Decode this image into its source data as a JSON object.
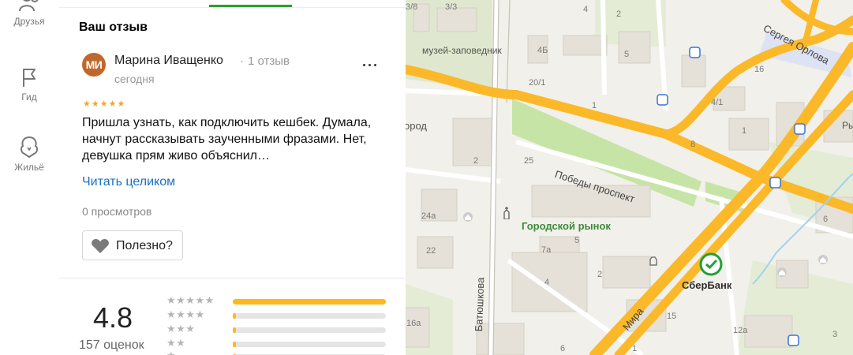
{
  "sidebar": {
    "items": [
      {
        "label": "Друзья",
        "icon": "friends-icon"
      },
      {
        "label": "Гид",
        "icon": "flag-icon"
      },
      {
        "label": "Жильё",
        "icon": "house-icon"
      }
    ]
  },
  "review": {
    "section_title": "Ваш отзыв",
    "author_initials": "МИ",
    "author_name": "Марина Иващенко",
    "author_reviews": "1 отзыв",
    "date": "сегодня",
    "stars": "★★★★★",
    "text": "Пришла узнать, как подключить кешбек. Думала, начнут рассказывать заученными фразами. Нет, девушка прям живо объяснил…",
    "read_more": "Читать целиком",
    "views": "0 просмотров",
    "useful_label": "Полезно?"
  },
  "rating": {
    "value": "4.8",
    "count": "157 оценок",
    "distribution": [
      {
        "stars": "★★★★★",
        "fraction": 1.0
      },
      {
        "stars": "★★★★",
        "fraction": 0.02
      },
      {
        "stars": "★★★",
        "fraction": 0.02
      },
      {
        "stars": "★★",
        "fraction": 0.02
      },
      {
        "stars": "★",
        "fraction": 0.02
      }
    ]
  },
  "map": {
    "labels": {
      "museum": "музей-заповедник",
      "market": "Городской рынок",
      "pobedy": "Победы проспект",
      "batyushkova": "Батюшкова",
      "mira": "Мира",
      "sergeya_orlova": "Сергея Орлова",
      "gorod_partial": "ород",
      "ry_partial": "Ры",
      "sberbank": "СберБанк"
    },
    "buildings": [
      "3/8",
      "3/3",
      "4",
      "2",
      "5",
      "4Б",
      "20/1",
      "1",
      "16",
      "4/1",
      "8",
      "1",
      "2",
      "25",
      "24а",
      "22",
      "5",
      "7а",
      "4",
      "2",
      "15",
      "16а",
      "6",
      "12а",
      "3",
      "1",
      "6"
    ]
  },
  "colors": {
    "accent_green": "#2d9e2d",
    "road_yellow": "#fbb829",
    "link_blue": "#1a6fc4",
    "star_orange": "#f5a623"
  }
}
